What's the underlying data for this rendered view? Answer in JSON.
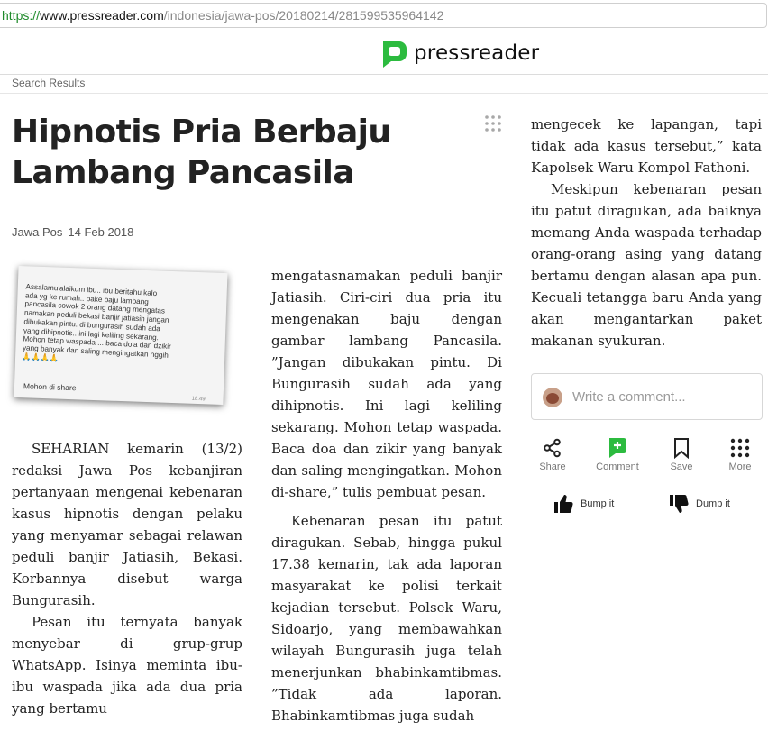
{
  "browser": {
    "url_scheme": "https://",
    "url_host": "www.pressreader.com",
    "url_path": "/indonesia/jawa-pos/20180214/281599535964142"
  },
  "brand": {
    "name": "pressreader",
    "accent": "#2cbb3f"
  },
  "breadcrumb": {
    "label": "Search Results"
  },
  "article": {
    "title": "Hipnotis Pria Berbaju Lambang Pancasila",
    "source": "Jawa Pos",
    "date": "14 Feb 2018",
    "photo": {
      "text": "Assalamu'alaikum ibu.. ibu beritahu kalo\nada yg ke rumah.. pake baju lambang\npancasila cowok 2 orang datang mengatas\nnamakan peduli bekasi banjir jatiasih jangan\ndibukakan pintu. di bungurasih sudah ada\nyang dihipnotis.. ini lagi keliling sekarang.\nMohon tetap waspada ... baca do'a dan dzikir\nyang banyak dan saling mengingatkan nggih\n🙏🙏🙏🙏",
      "footer": "Mohon di share",
      "time": "18.49"
    },
    "paragraphs": {
      "p1": "SEHARIAN kemarin (13/2) redaksi Jawa Pos kebanjiran pertanyaan mengenai kebenaran kasus hipnotis dengan pelaku yang menyamar sebagai relawan peduli banjir Jatiasih, Bekasi. Korbannya disebut warga Bungurasih.",
      "p2a": "Pesan itu ternyata banyak menyebar di grup-grup WhatsApp. Isinya meminta ibu-ibu waspada jika ada dua pria yang bertamu",
      "p2b": "mengatasnamakan peduli banjir Jatiasih. Ciri-ciri dua pria itu mengenakan baju dengan gambar lambang Pancasila. ”Jangan dibukakan pintu. Di Bungurasih sudah ada yang dihipnotis. Ini lagi keliling sekarang. Mohon tetap waspada. Baca doa dan zikir yang banyak dan saling mengingatkan. Mohon di-share,” tulis pembuat pesan.",
      "p3": "Kebenaran pesan itu patut diragukan. Sebab, hingga pukul 17.38 kemarin, tak ada laporan masyarakat ke polisi terkait kejadian tersebut. Polsek Waru, Sidoarjo, yang membawahkan wilayah Bungurasih juga telah menerjunkan bhabinkamtibmas. ”Tidak ada laporan. Bhabinkamtibmas juga sudah",
      "p3b": "mengecek ke lapangan, tapi tidak ada kasus tersebut,” kata Kapolsek Waru Kompol Fathoni.",
      "p4": "Meskipun kebenaran pesan itu patut diragukan, ada baiknya memang Anda waspada terhadap orang-orang asing yang datang bertamu dengan alasan apa pun. Kecuali tetangga baru Anda yang akan mengantarkan paket makanan syukuran."
    }
  },
  "comment": {
    "placeholder": "Write a comment..."
  },
  "actions": {
    "share": "Share",
    "comment": "Comment",
    "save": "Save",
    "more": "More",
    "bump": "Bump it",
    "dump": "Dump it",
    "icons": [
      "share-icon",
      "comment-plus-icon",
      "bookmark-icon",
      "more-grid-icon",
      "thumbs-up-icon",
      "thumbs-down-icon"
    ]
  }
}
